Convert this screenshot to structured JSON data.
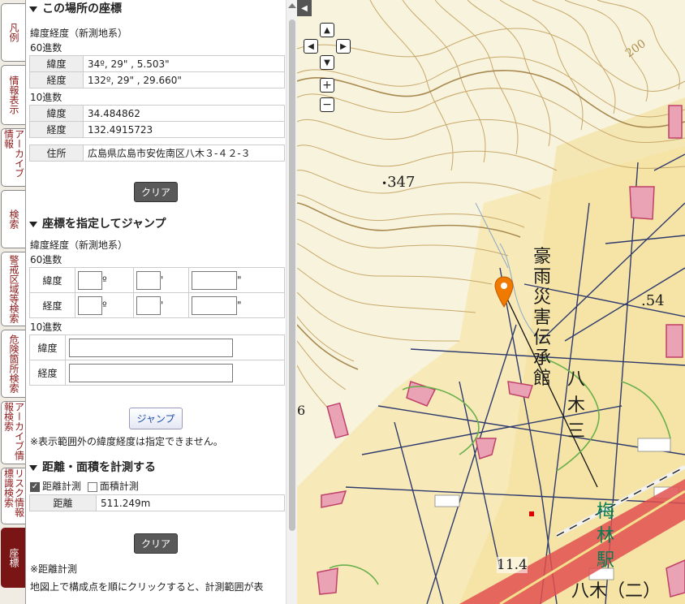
{
  "tabs": [
    {
      "label": "凡例"
    },
    {
      "label": "情報表示"
    },
    {
      "label": "アーカイブ情報"
    },
    {
      "label": "検索"
    },
    {
      "label": "警戒区域等検索"
    },
    {
      "label": "危険箇所検索"
    },
    {
      "label": "アーカイブ情報検索"
    },
    {
      "label": "リスク情報標識検索"
    },
    {
      "label": "座標"
    }
  ],
  "coord_section": {
    "title": "この場所の座標",
    "datum_label": "緯度経度（新測地系）",
    "sexagesimal_label": "60進数",
    "lat_label": "緯度",
    "lat_dms": "34º, 29\" , 5.503\"",
    "lon_label": "経度",
    "lon_dms": "132º, 29\" , 29.660\"",
    "decimal_label": "10進数",
    "lat_dec": "34.484862",
    "lon_dec": "132.4915723",
    "address_label": "住所",
    "address": "広島県広島市安佐南区八木３-４２-３",
    "clear_button": "クリア"
  },
  "jump_section": {
    "title": "座標を指定してジャンプ",
    "datum_label": "緯度経度（新測地系）",
    "sexagesimal_label": "60進数",
    "lat_label": "緯度",
    "lon_label": "経度",
    "deg": "º",
    "min": "'",
    "sec": "\"",
    "decimal_label": "10進数",
    "jump_button": "ジャンプ",
    "note": "※表示範囲外の緯度経度は指定できません。"
  },
  "measure_section": {
    "title": "距離・面積を計測する",
    "distance_check": "距離計測",
    "distance_checked": true,
    "area_check": "面積計測",
    "area_checked": false,
    "distance_label": "距離",
    "distance_value": "511.249m",
    "clear_button": "クリア",
    "note1": "※距離計測",
    "note2": "地図上で構成点を順にクリックすると、計測範囲が表"
  },
  "map": {
    "elev_347": "347",
    "elev_54": ".54",
    "contour_200": "200",
    "elev_11": "11.4",
    "memorial": [
      "豪",
      "雨",
      "災",
      "害",
      "伝",
      "承",
      "館"
    ],
    "yagi3": [
      "八",
      "木",
      "三"
    ],
    "station": [
      "梅",
      "林",
      "駅"
    ],
    "yagi2": "八木（二）",
    "six": "6",
    "marker_color": "#f07a00"
  }
}
